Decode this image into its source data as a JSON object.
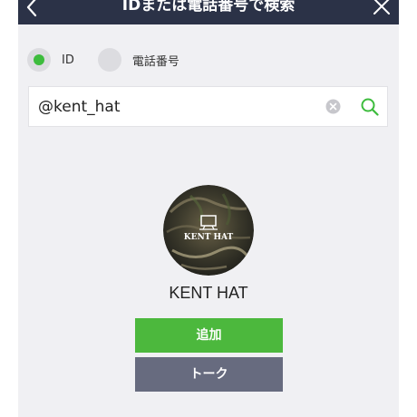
{
  "navbar": {
    "title": "IDまたは電話番号で検索",
    "back_icon": "chevron-left-icon",
    "close_icon": "close-icon",
    "background": "#2b3247"
  },
  "search_type": {
    "options": [
      {
        "label": "ID",
        "selected": true
      },
      {
        "label": "電話番号",
        "selected": false
      }
    ],
    "accent": "#3dbc3d"
  },
  "search": {
    "value": "@kent_hat",
    "clear_icon": "clear-icon",
    "search_icon": "search-icon"
  },
  "result": {
    "avatar_text": "KENT HAT",
    "name": "KENT HAT"
  },
  "actions": {
    "add_label": "追加",
    "talk_label": "トーク",
    "add_color": "#4cb83d",
    "talk_color": "#676b7f"
  }
}
